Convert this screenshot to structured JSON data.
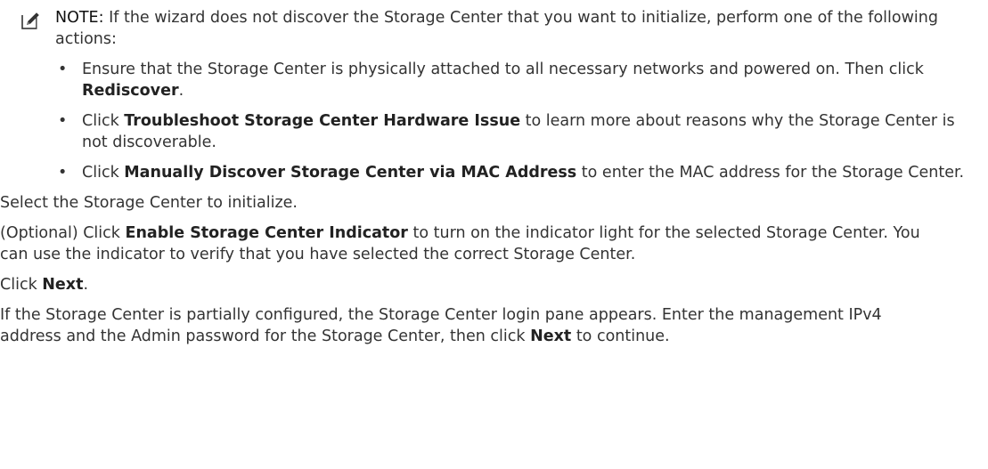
{
  "note": {
    "label": "NOTE:",
    "lead": " If the wizard does not discover the Storage Center that you want to initialize, perform one of the following actions:",
    "items": [
      {
        "before": "Ensure that the Storage Center is physically attached to all necessary networks and powered on. Then click ",
        "bold": "Rediscover",
        "after": "."
      },
      {
        "before": "Click ",
        "bold": "Troubleshoot Storage Center Hardware Issue",
        "after": " to learn more about reasons why the Storage Center is not discoverable."
      },
      {
        "before": "Click ",
        "bold": "Manually Discover Storage Center via MAC Address",
        "after": " to enter the MAC address for the Storage Center."
      }
    ]
  },
  "steps": {
    "select": "Select the Storage Center to initialize.",
    "optional_before": "(Optional) Click ",
    "optional_bold": "Enable Storage Center Indicator",
    "optional_after": " to turn on the indicator light for the selected Storage Center. You can use the indicator to verify that you have selected the correct Storage Center.",
    "next_before": "Click ",
    "next_bold": "Next",
    "next_after": ".",
    "partial_before": "If the Storage Center is partially configured, the Storage Center login pane appears. Enter the management IPv4 address and the Admin password for the Storage Center, then click ",
    "partial_bold": "Next",
    "partial_after": " to continue."
  },
  "icons": {
    "note": "pencil-note-icon"
  }
}
